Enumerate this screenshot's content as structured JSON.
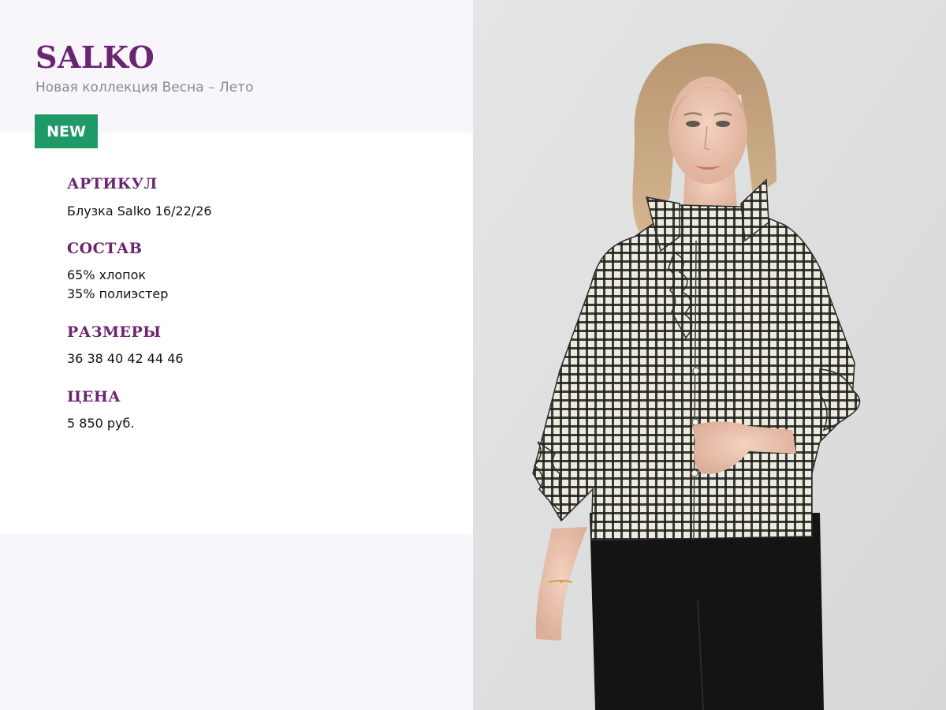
{
  "header": {
    "brand": "SALKO",
    "subtitle": "Новая коллекция Весна – Лето",
    "badge": "NEW"
  },
  "details": {
    "article": {
      "label": "АРТИКУЛ",
      "value": "Блузка Salko 16/22/26"
    },
    "composition": {
      "label": "СОСТАВ",
      "lines": [
        "65% хлопок",
        "35% полиэстер"
      ]
    },
    "sizes": {
      "label": "РАЗМЕРЫ",
      "value": "36 38 40 42 44 46"
    },
    "price": {
      "label": "ЦЕНА",
      "value": "5 850 руб."
    }
  },
  "colors": {
    "brand_purple": "#6b2470",
    "badge_green": "#1f9966",
    "subtitle_gray": "#8a8a8a"
  }
}
